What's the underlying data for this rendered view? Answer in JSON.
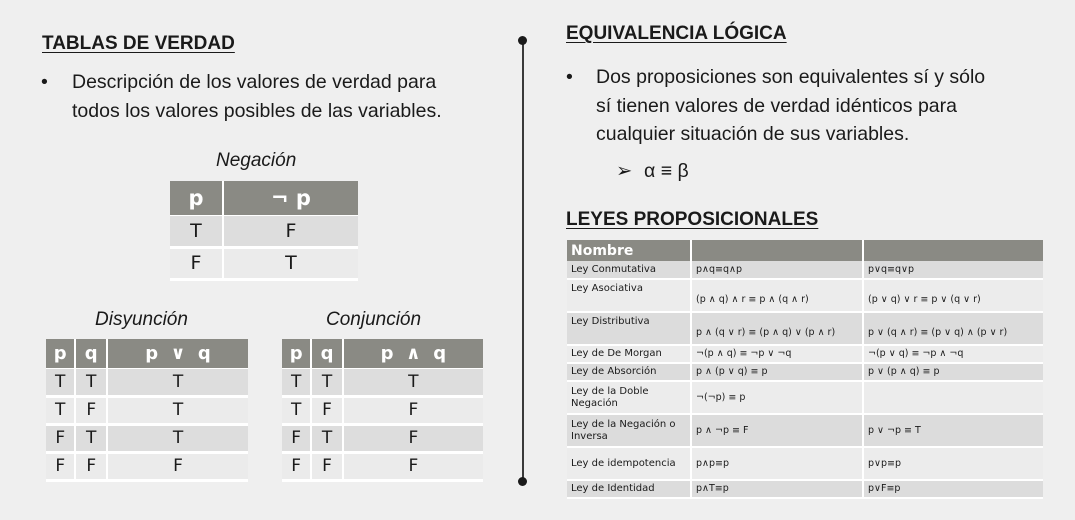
{
  "left": {
    "heading": "TABLAS DE VERDAD",
    "bullet_symbol": "•",
    "bullet_line1": "Descripción de los valores de verdad para",
    "bullet_line2": "todos los valores posibles de las variables.",
    "negacion": {
      "caption": "Negación",
      "headers": [
        "p",
        "¬ p"
      ],
      "rows": [
        [
          "T",
          "F"
        ],
        [
          "F",
          "T"
        ]
      ]
    },
    "disyuncion": {
      "caption": "Disyunción",
      "headers": [
        "p",
        "q",
        "p  ∨  q"
      ],
      "rows": [
        [
          "T",
          "T",
          "T"
        ],
        [
          "T",
          "F",
          "T"
        ],
        [
          "F",
          "T",
          "T"
        ],
        [
          "F",
          "F",
          "F"
        ]
      ]
    },
    "conjuncion": {
      "caption": "Conjunción",
      "headers": [
        "p",
        "q",
        "p  ∧  q"
      ],
      "rows": [
        [
          "T",
          "T",
          "T"
        ],
        [
          "T",
          "F",
          "F"
        ],
        [
          "F",
          "T",
          "F"
        ],
        [
          "F",
          "F",
          "F"
        ]
      ]
    }
  },
  "right": {
    "heading": "EQUIVALENCIA LÓGICA",
    "bullet_symbol": "•",
    "bullet_line1": "Dos proposiciones son equivalentes sí y sólo",
    "bullet_line2": "sí tienen valores de verdad idénticos para",
    "bullet_line3": "cualquier situación de sus variables.",
    "sub_arrow": "➢",
    "sub_text": "α ≡ β",
    "laws_heading": "LEYES PROPOSICIONALES",
    "laws_table": {
      "headers": [
        "Nombre",
        "",
        ""
      ],
      "rows": [
        [
          "Ley Conmutativa",
          "p∧q≡q∧p",
          "p∨q≡q∨p"
        ],
        [
          "Ley Asociativa",
          "(p ∧ q) ∧ r ≡ p ∧ (q ∧ r)",
          "(p ∨ q) ∨ r ≡ p ∨ (q ∨ r)"
        ],
        [
          "Ley Distributiva",
          "p ∧ (q ∨ r) ≡ (p ∧ q) ∨ (p ∧ r)",
          "p ∨ (q ∧ r) ≡ (p ∨ q) ∧ (p ∨ r)"
        ],
        [
          "Ley de De Morgan",
          "¬(p ∧ q) ≡ ¬p ∨ ¬q",
          "¬(p ∨ q) ≡ ¬p ∧ ¬q"
        ],
        [
          "Ley de Absorción",
          "p ∧ (p ∨ q) ≡ p",
          "p ∨ (p ∧ q) ≡ p"
        ],
        [
          "Ley de la Doble Negación",
          "¬(¬p) ≡ p",
          ""
        ],
        [
          "Ley de la Negación o Inversa",
          "p ∧ ¬p ≡ F",
          "p ∨ ¬p ≡ T"
        ],
        [
          "Ley de idempotencia",
          "p∧p≡p",
          "p∨p≡p"
        ],
        [
          "Ley de Identidad",
          "p∧T≡p",
          "p∨F≡p"
        ]
      ]
    }
  }
}
